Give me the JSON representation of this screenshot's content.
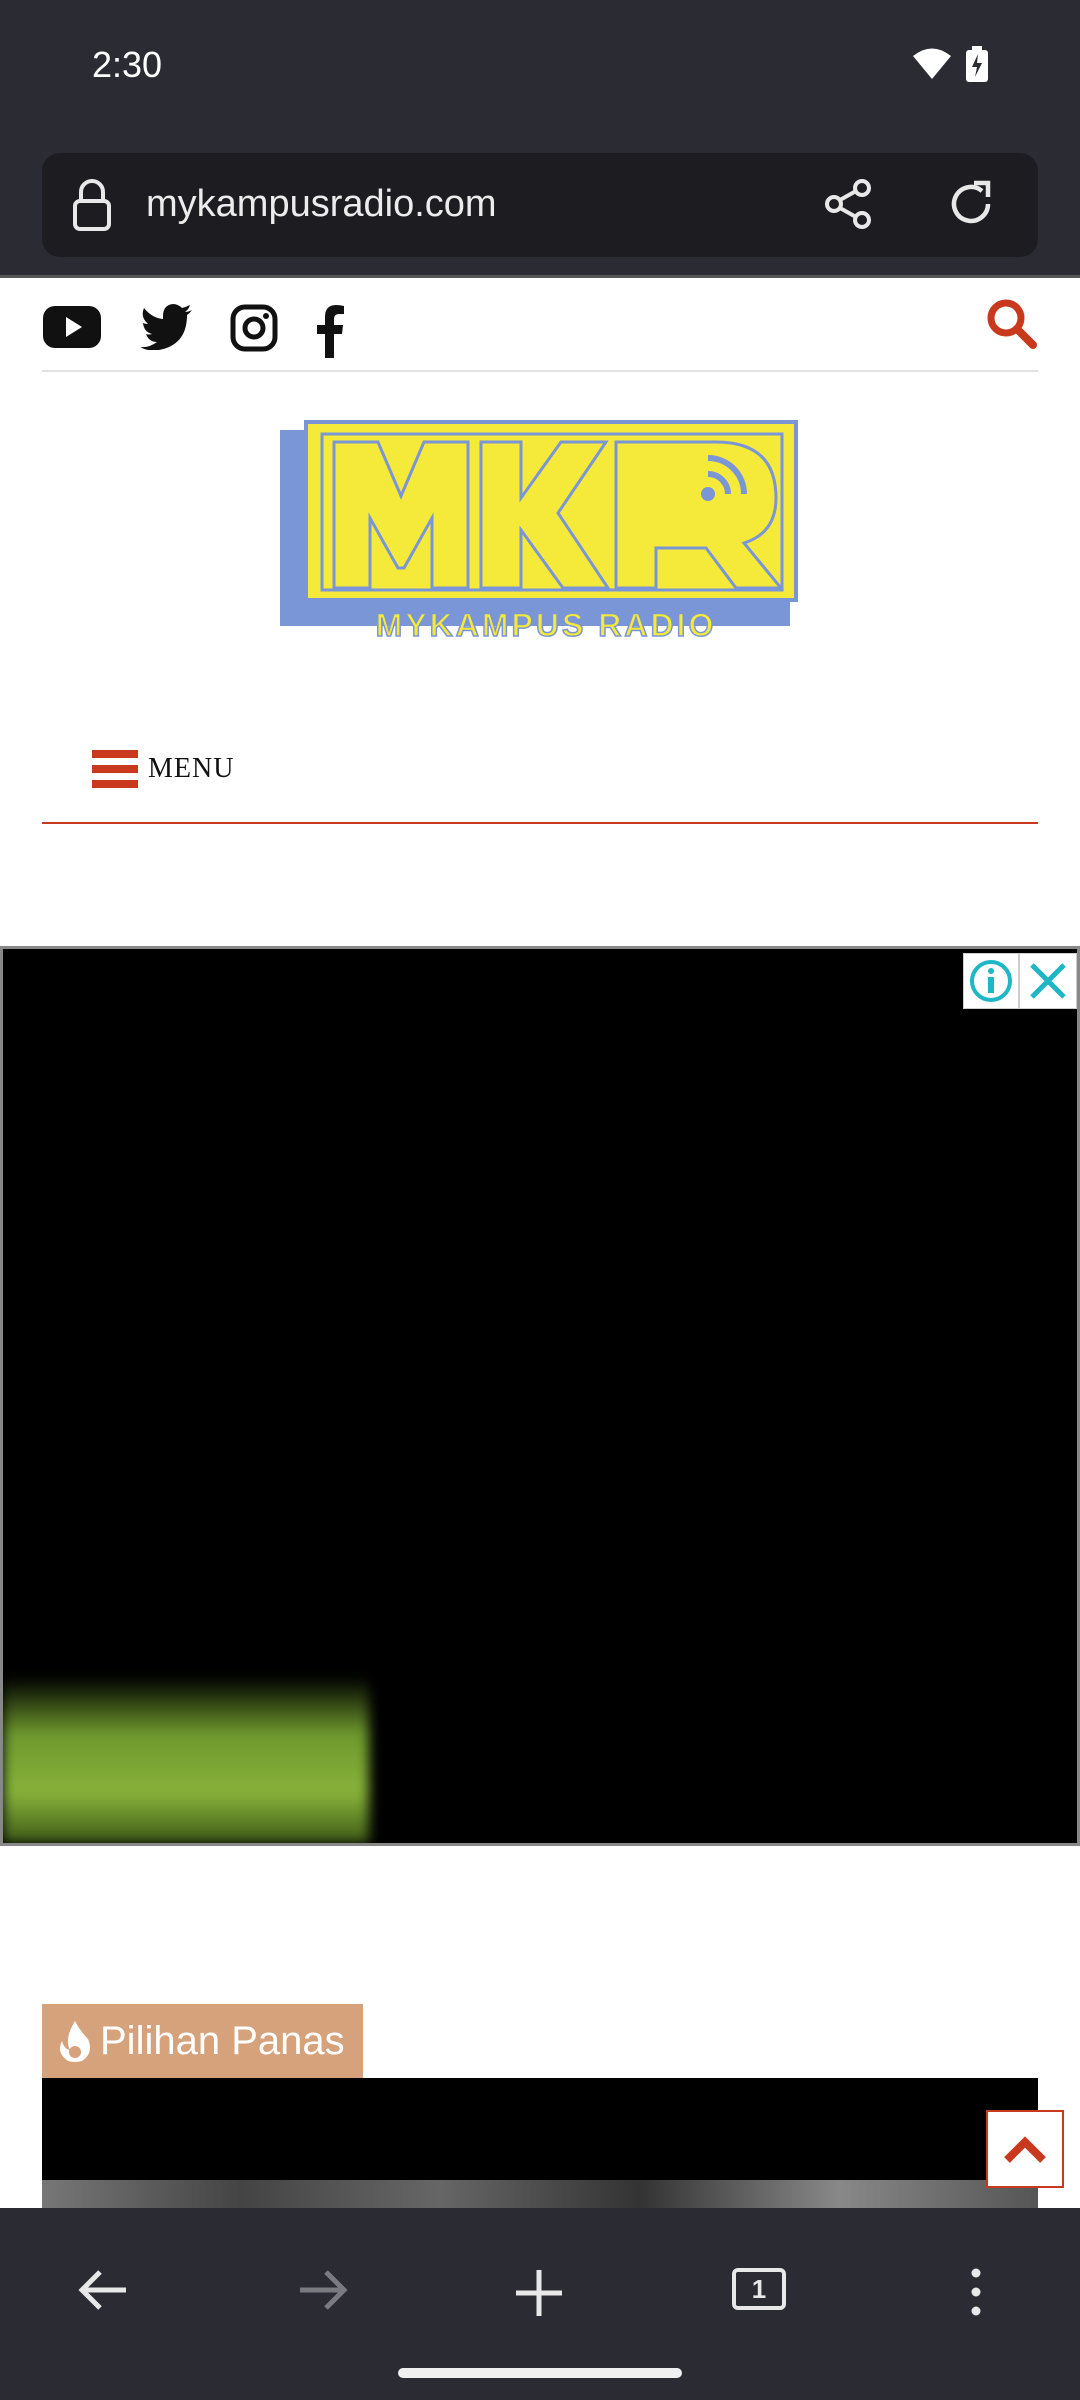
{
  "status_bar": {
    "time": "2:30"
  },
  "browser": {
    "url": "mykampusradio.com",
    "tab_count": "1"
  },
  "site": {
    "logo_text": "MKR",
    "logo_subtext": "MYKAMPUS RADIO",
    "menu_label": "MENU",
    "social_icons": [
      "youtube-icon",
      "twitter-icon",
      "instagram-icon",
      "facebook-icon"
    ]
  },
  "section": {
    "title": "Pilihan Panas"
  },
  "colors": {
    "browser_chrome": "#2b2b33",
    "accent_red": "#c8391e",
    "section_tag": "#d6a27b",
    "logo_yellow": "#f5ea3a",
    "logo_blue": "#7b96d6"
  }
}
